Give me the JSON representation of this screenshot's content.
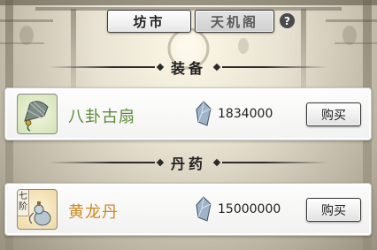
{
  "tabs": [
    {
      "label": "坊市",
      "active": true
    },
    {
      "label": "天机阁",
      "active": false
    }
  ],
  "help": {
    "label": "?"
  },
  "sections": [
    {
      "title": "装备",
      "items": [
        {
          "name": "八卦古扇",
          "price": "1834000",
          "buy_label": "购买",
          "icon": "fan-item-icon",
          "name_color": "#5c8a3a"
        }
      ]
    },
    {
      "title": "丹药",
      "items": [
        {
          "name": "黄龙丹",
          "price": "15000000",
          "buy_label": "购买",
          "icon": "gourd-item-icon",
          "grade": "七阶",
          "name_color": "#cc8a22"
        }
      ]
    }
  ],
  "currency_icon": "spirit-crystal-icon"
}
